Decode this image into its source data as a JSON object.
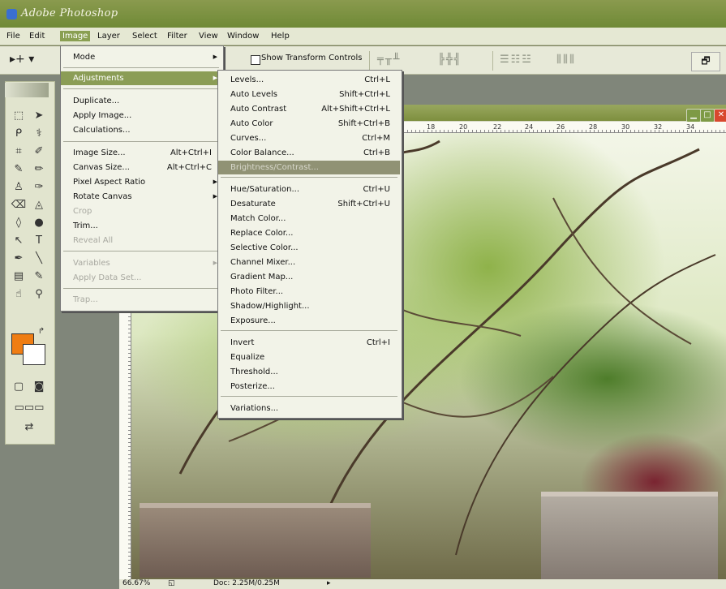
{
  "app": {
    "title": "Adobe Photoshop"
  },
  "menubar": [
    "File",
    "Edit",
    "Image",
    "Layer",
    "Select",
    "Filter",
    "View",
    "Window",
    "Help"
  ],
  "options": {
    "show_transform_controls": "Show Transform Controls",
    "checked": false
  },
  "image_menu": [
    {
      "label": "Mode",
      "arrow": true
    },
    {
      "label": "Adjustments",
      "arrow": true,
      "highlighted": true
    },
    {
      "label": "Duplicate..."
    },
    {
      "label": "Apply Image..."
    },
    {
      "label": "Calculations..."
    },
    {
      "label": "Image Size...",
      "shortcut": "Alt+Ctrl+I"
    },
    {
      "label": "Canvas Size...",
      "shortcut": "Alt+Ctrl+C"
    },
    {
      "label": "Pixel Aspect Ratio",
      "arrow": true
    },
    {
      "label": "Rotate Canvas",
      "arrow": true
    },
    {
      "label": "Crop",
      "disabled": true
    },
    {
      "label": "Trim..."
    },
    {
      "label": "Reveal All",
      "disabled": true
    },
    {
      "label": "Variables",
      "arrow": true,
      "disabled": true
    },
    {
      "label": "Apply Data Set...",
      "disabled": true
    },
    {
      "label": "Trap...",
      "disabled": true
    }
  ],
  "adjustments_menu": [
    {
      "label": "Levels...",
      "shortcut": "Ctrl+L"
    },
    {
      "label": "Auto Levels",
      "shortcut": "Shift+Ctrl+L"
    },
    {
      "label": "Auto Contrast",
      "shortcut": "Alt+Shift+Ctrl+L"
    },
    {
      "label": "Auto Color",
      "shortcut": "Shift+Ctrl+B"
    },
    {
      "label": "Curves...",
      "shortcut": "Ctrl+M"
    },
    {
      "label": "Color Balance...",
      "shortcut": "Ctrl+B"
    },
    {
      "label": "Brightness/Contrast...",
      "highlighted": true
    },
    {
      "label": "Hue/Saturation...",
      "shortcut": "Ctrl+U"
    },
    {
      "label": "Desaturate",
      "shortcut": "Shift+Ctrl+U"
    },
    {
      "label": "Match Color..."
    },
    {
      "label": "Replace Color..."
    },
    {
      "label": "Selective Color..."
    },
    {
      "label": "Channel Mixer..."
    },
    {
      "label": "Gradient Map..."
    },
    {
      "label": "Photo Filter..."
    },
    {
      "label": "Shadow/Highlight..."
    },
    {
      "label": "Exposure..."
    },
    {
      "label": "Invert",
      "shortcut": "Ctrl+I"
    },
    {
      "label": "Equalize"
    },
    {
      "label": "Threshold..."
    },
    {
      "label": "Posterize..."
    },
    {
      "label": "Variations..."
    }
  ],
  "ruler_labels": [
    "18",
    "20",
    "22",
    "24",
    "26",
    "28",
    "30",
    "32",
    "34"
  ],
  "status": {
    "zoom": "66.67%",
    "doc": "Doc: 2.25M/0.25M"
  },
  "colors": {
    "foreground": "#ef7d13",
    "background": "#ffffff",
    "menu_highlight": "#8b9d56"
  }
}
